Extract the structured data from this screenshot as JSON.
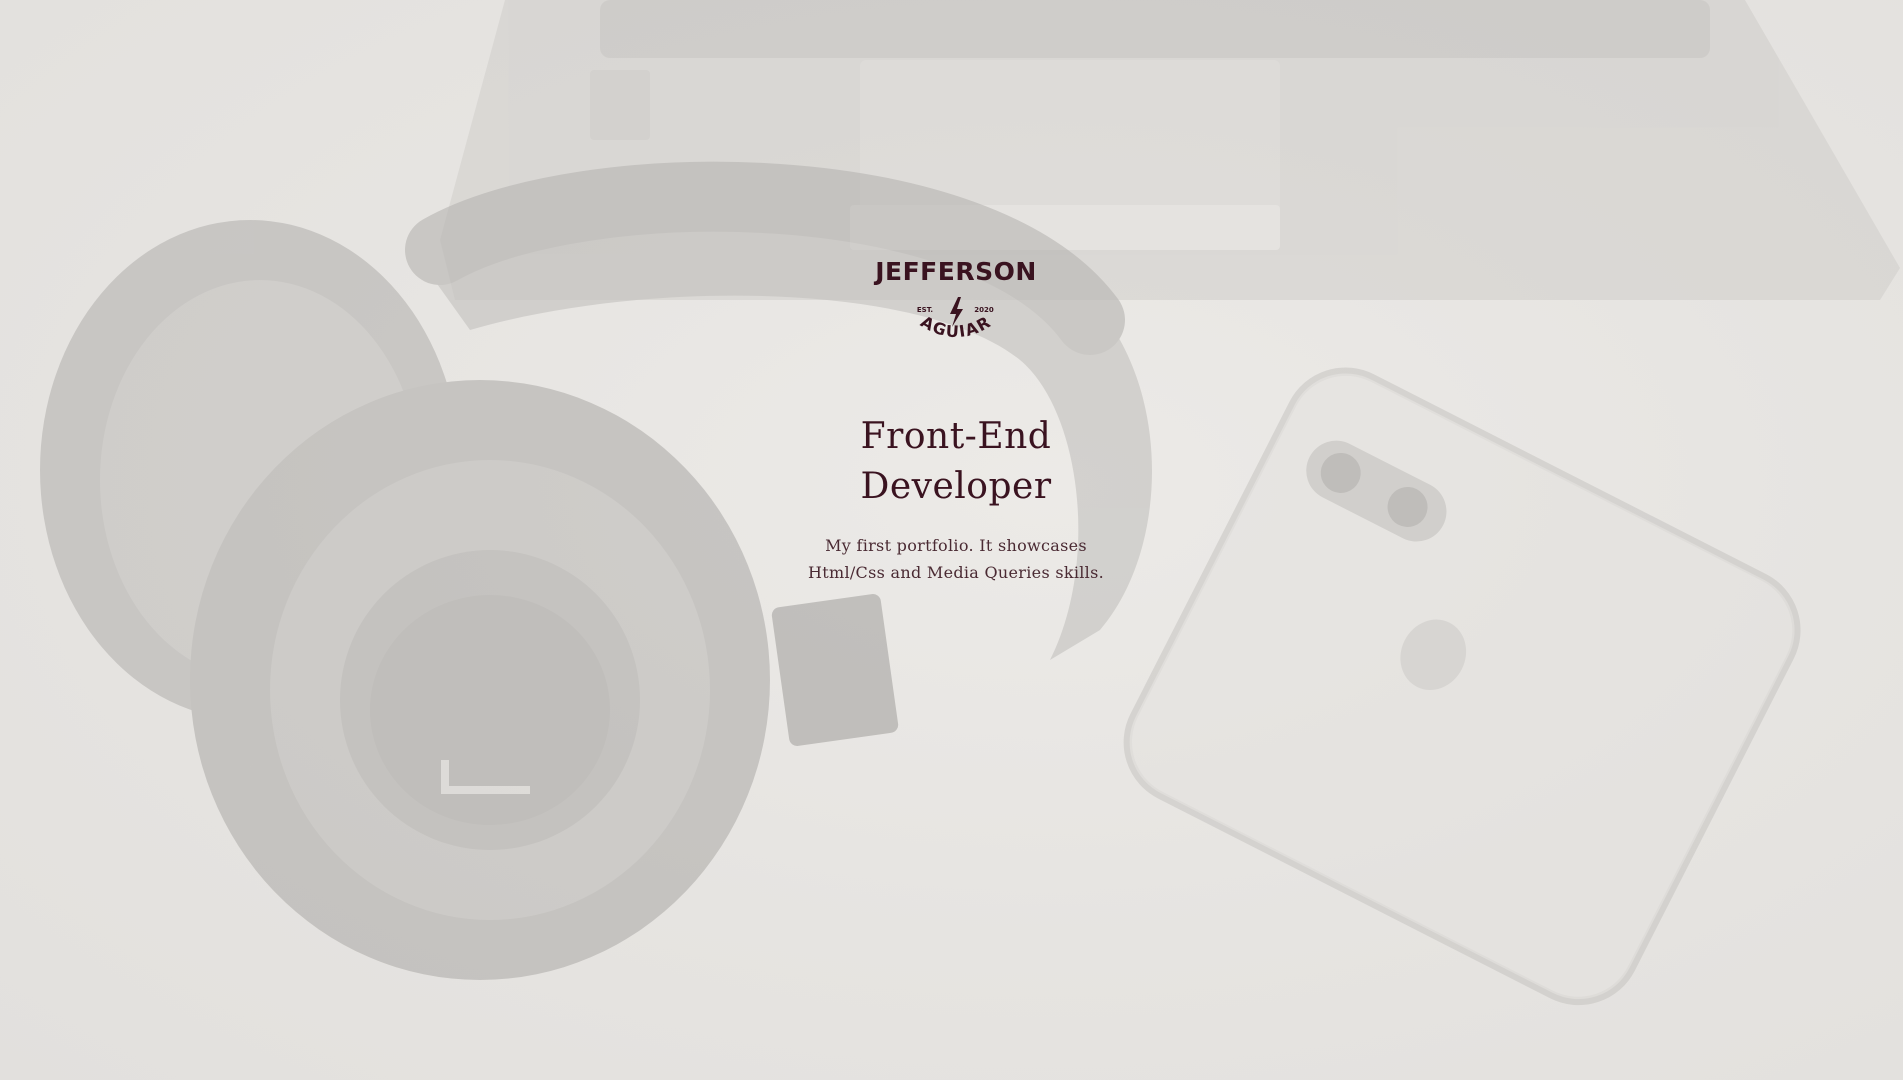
{
  "logo": {
    "name_top": "JEFFERSON",
    "name_bottom": "AGUIAR",
    "est_label": "EST.",
    "year": "2020",
    "bolt_icon": "lightning-bolt-icon"
  },
  "hero": {
    "heading_line1": "Front-End",
    "heading_line2": "Developer",
    "description_line1": "My first portfolio. It showcases",
    "description_line2": "Html/Css and Media Queries skills."
  },
  "colors": {
    "brand": "#3a1320",
    "background": "#e9e8e5"
  }
}
